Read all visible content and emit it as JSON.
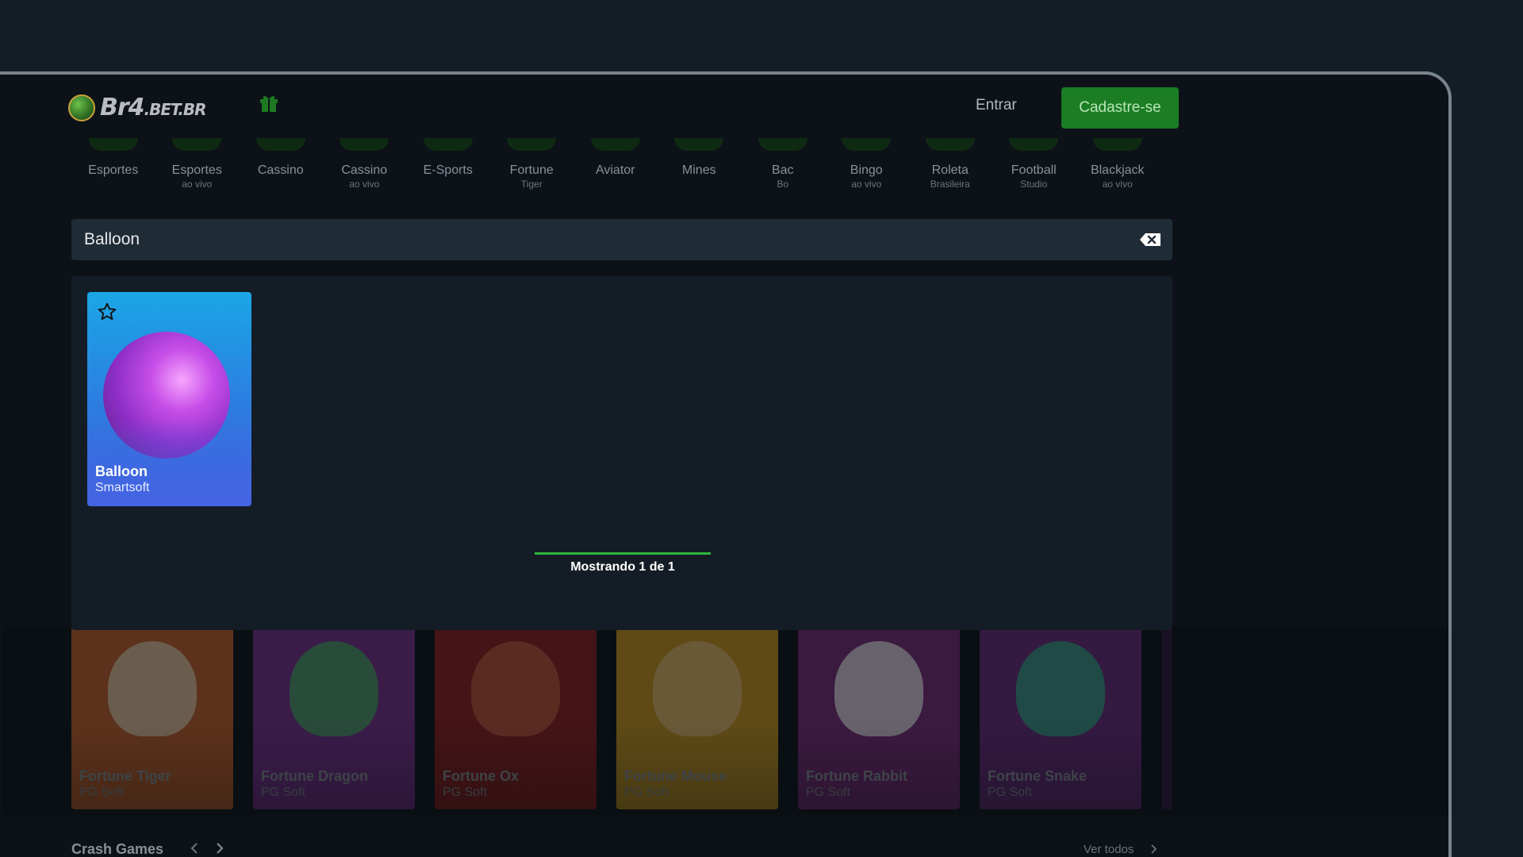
{
  "brand": {
    "logo_text": "Br4",
    "logo_suffix": ".BET.BR"
  },
  "header": {
    "login_label": "Entrar",
    "register_label": "Cadastre-se"
  },
  "nav": [
    {
      "label": "Esportes",
      "sub": ""
    },
    {
      "label": "Esportes",
      "sub": "ao vivo"
    },
    {
      "label": "Cassino",
      "sub": ""
    },
    {
      "label": "Cassino",
      "sub": "ao vivo"
    },
    {
      "label": "E-Sports",
      "sub": ""
    },
    {
      "label": "Fortune",
      "sub": "Tiger"
    },
    {
      "label": "Aviator",
      "sub": ""
    },
    {
      "label": "Mines",
      "sub": ""
    },
    {
      "label": "Bac",
      "sub": "Bo"
    },
    {
      "label": "Bingo",
      "sub": "ao vivo"
    },
    {
      "label": "Roleta",
      "sub": "Brasileira"
    },
    {
      "label": "Football",
      "sub": "Studio"
    },
    {
      "label": "Blackjack",
      "sub": "ao vivo"
    }
  ],
  "search": {
    "value": "Balloon"
  },
  "results": {
    "cards": [
      {
        "title": "Balloon",
        "provider": "Smartsoft"
      }
    ],
    "showing_text": "Mostrando 1 de 1",
    "progress_fraction": 1.0
  },
  "games": [
    {
      "title": "Fortune Tiger",
      "provider": "PG Soft",
      "bg": "#c4602a",
      "art": "#e8c9a6"
    },
    {
      "title": "Fortune Dragon",
      "provider": "PG Soft",
      "bg": "#7a2f8f",
      "art": "#4fa36a"
    },
    {
      "title": "Fortune Ox",
      "provider": "PG Soft",
      "bg": "#8e1e1e",
      "art": "#c8563a"
    },
    {
      "title": "Fortune Mouse",
      "provider": "PG Soft",
      "bg": "#c9961d",
      "art": "#e3b870"
    },
    {
      "title": "Fortune Rabbit",
      "provider": "PG Soft",
      "bg": "#7b2a7a",
      "art": "#e8dde8"
    },
    {
      "title": "Fortune Snake",
      "provider": "PG Soft",
      "bg": "#6a2a7d",
      "art": "#3aa08a"
    }
  ],
  "crash": {
    "title": "Crash Games",
    "see_all": "Ver todos"
  },
  "colors": {
    "accent": "#1b7d24",
    "progress": "#2fb43a",
    "panel": "#141d25",
    "search_bg": "#1f2b35"
  },
  "icons": {
    "gift": "gift-icon",
    "clear": "backspace-clear-icon",
    "favorite": "star-outline-icon"
  }
}
